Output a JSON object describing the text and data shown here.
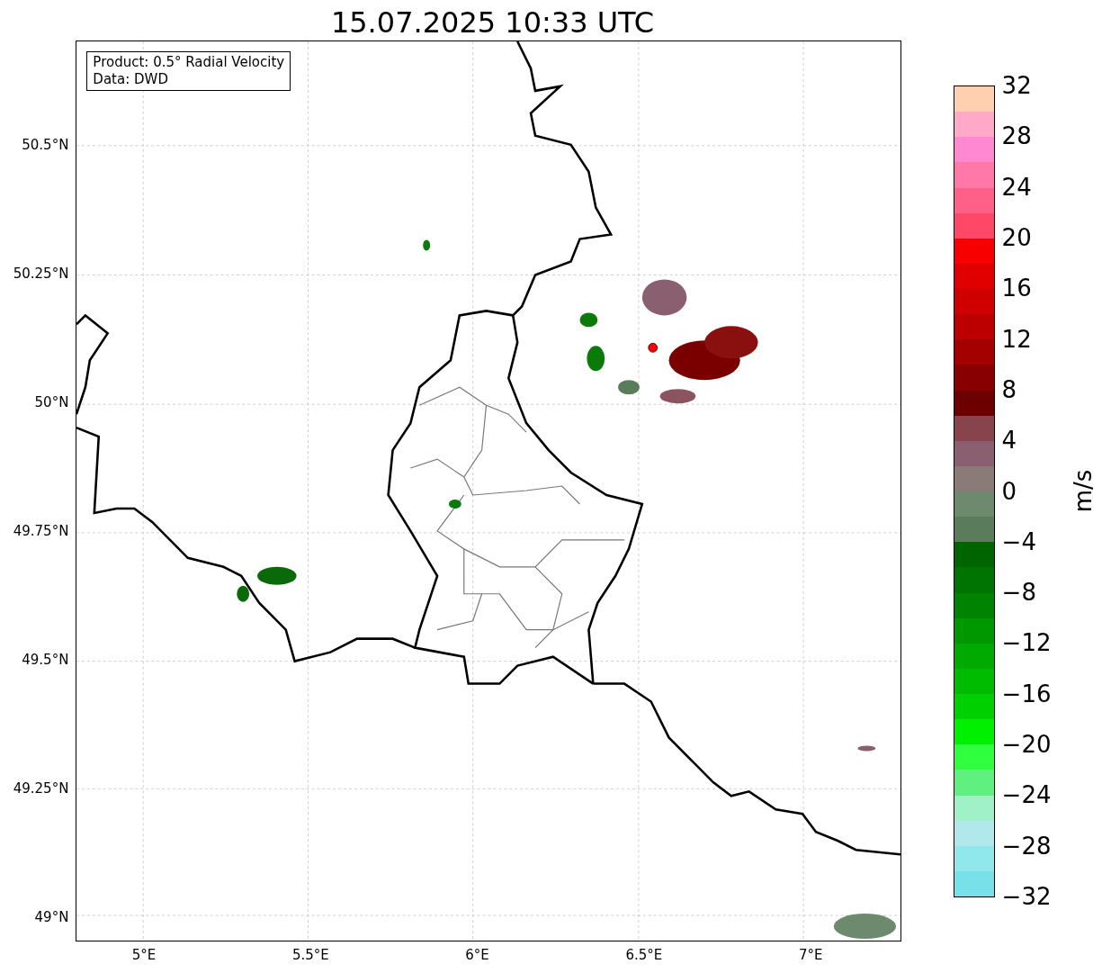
{
  "title": "15.07.2025 10:33 UTC",
  "legend": [
    "Product: 0.5° Radial Velocity",
    "Data: DWD"
  ],
  "y_ticks": [
    "50.5°N",
    "50.25°N",
    "50°N",
    "49.75°N",
    "49.5°N",
    "49.25°N",
    "49°N"
  ],
  "x_ticks": [
    "5°E",
    "5.5°E",
    "6°E",
    "6.5°E",
    "7°E"
  ],
  "colorbar": {
    "label": "m/s",
    "ticks": [
      "32",
      "28",
      "24",
      "20",
      "16",
      "12",
      "8",
      "4",
      "0",
      "−4",
      "−8",
      "−12",
      "−16",
      "−20",
      "−24",
      "−28",
      "−32"
    ],
    "bands": [
      {
        "color": "#ffd0b0"
      },
      {
        "color": "#ffa8c8"
      },
      {
        "color": "#ff88d0"
      },
      {
        "color": "#ff78a8"
      },
      {
        "color": "#ff6088"
      },
      {
        "color": "#ff4868"
      },
      {
        "color": "#f80000"
      },
      {
        "color": "#e00000"
      },
      {
        "color": "#d00000"
      },
      {
        "color": "#bc0000"
      },
      {
        "color": "#a40000"
      },
      {
        "color": "#880000"
      },
      {
        "color": "#6c0000"
      },
      {
        "color": "#88444c"
      },
      {
        "color": "#8a6070"
      },
      {
        "color": "#8a7a78"
      },
      {
        "color": "#6e8a6e"
      },
      {
        "color": "#5a7c5a"
      },
      {
        "color": "#006400"
      },
      {
        "color": "#007400"
      },
      {
        "color": "#008400"
      },
      {
        "color": "#009800"
      },
      {
        "color": "#00aa00"
      },
      {
        "color": "#00bc00"
      },
      {
        "color": "#00d000"
      },
      {
        "color": "#00f000"
      },
      {
        "color": "#30ff40"
      },
      {
        "color": "#60f080"
      },
      {
        "color": "#a0f0c8"
      },
      {
        "color": "#b0e8ec"
      },
      {
        "color": "#90e8ec"
      },
      {
        "color": "#78e0e8"
      }
    ]
  }
}
